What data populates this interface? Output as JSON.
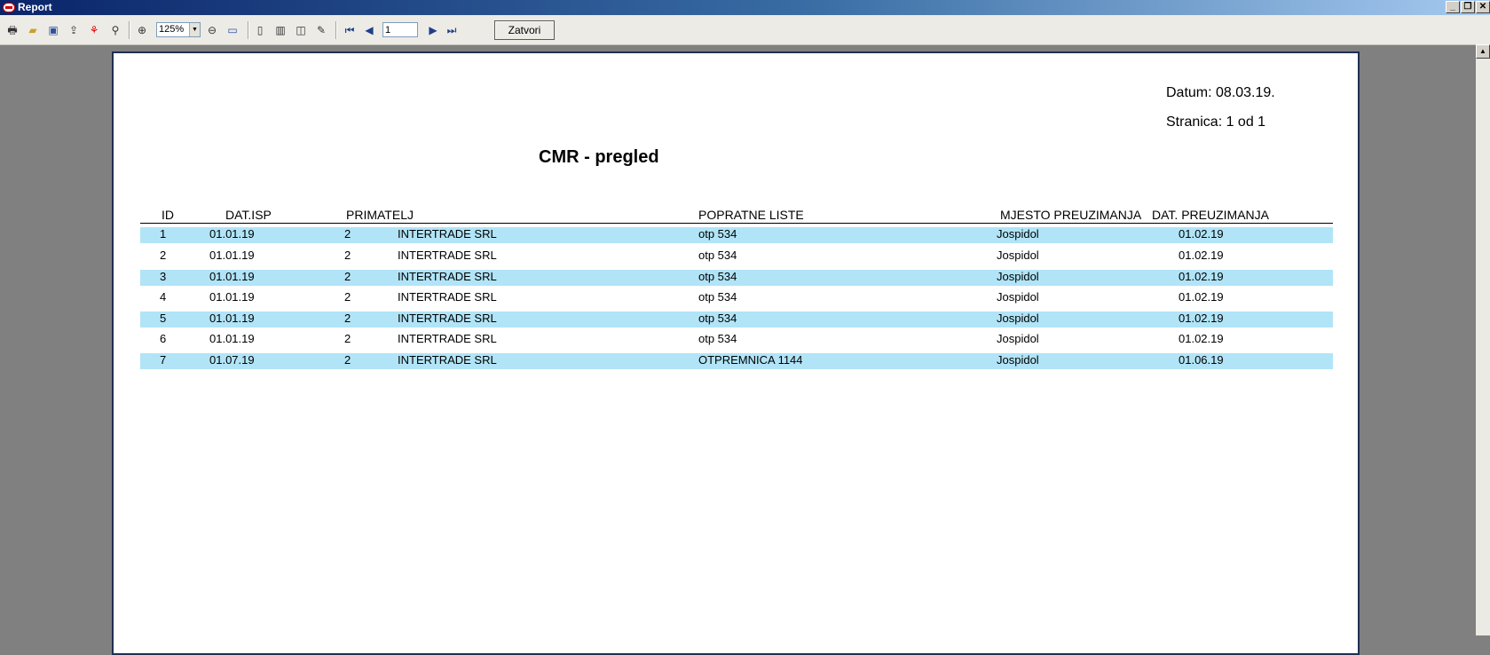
{
  "window": {
    "title": "Report"
  },
  "toolbar": {
    "zoom_value": "125%",
    "page_number": "1",
    "close_label": "Zatvori",
    "icons": [
      "print-icon",
      "open-icon",
      "save-icon",
      "export-icon",
      "pdf-icon",
      "find-icon",
      "zoom-in-icon",
      "zoom-out-icon",
      "fit-page-icon",
      "single-page-icon",
      "two-page-icon",
      "book-view-icon",
      "edit-icon",
      "first-page-icon",
      "prev-page-icon",
      "next-page-icon",
      "last-page-icon"
    ]
  },
  "report": {
    "datum": "Datum: 08.03.19.",
    "stranica": "Stranica: 1 od 1",
    "title": "CMR - pregled",
    "columns": [
      "ID",
      "DAT.ISP",
      "PRIMATELJ",
      "POPRATNE LISTE",
      "MJESTO PREUZIMANJA",
      "DAT. PREUZIMANJA"
    ],
    "rows": [
      {
        "id": "1",
        "dat_isp": "01.01.19",
        "prim_code": "2",
        "prim_name": "INTERTRADE SRL",
        "popratne": "otp 534",
        "mjesto": "Jospidol",
        "dat_preuz": "01.02.19"
      },
      {
        "id": "2",
        "dat_isp": "01.01.19",
        "prim_code": "2",
        "prim_name": "INTERTRADE SRL",
        "popratne": "otp 534",
        "mjesto": "Jospidol",
        "dat_preuz": "01.02.19"
      },
      {
        "id": "3",
        "dat_isp": "01.01.19",
        "prim_code": "2",
        "prim_name": "INTERTRADE SRL",
        "popratne": "otp 534",
        "mjesto": "Jospidol",
        "dat_preuz": "01.02.19"
      },
      {
        "id": "4",
        "dat_isp": "01.01.19",
        "prim_code": "2",
        "prim_name": "INTERTRADE SRL",
        "popratne": "otp 534",
        "mjesto": "Jospidol",
        "dat_preuz": "01.02.19"
      },
      {
        "id": "5",
        "dat_isp": "01.01.19",
        "prim_code": "2",
        "prim_name": "INTERTRADE SRL",
        "popratne": "otp 534",
        "mjesto": "Jospidol",
        "dat_preuz": "01.02.19"
      },
      {
        "id": "6",
        "dat_isp": "01.01.19",
        "prim_code": "2",
        "prim_name": "INTERTRADE SRL",
        "popratne": "otp 534",
        "mjesto": "Jospidol",
        "dat_preuz": "01.02.19"
      },
      {
        "id": "7",
        "dat_isp": "01.07.19",
        "prim_code": "2",
        "prim_name": "INTERTRADE SRL",
        "popratne": "OTPREMNICA 1144",
        "mjesto": "Jospidol",
        "dat_preuz": "01.06.19"
      }
    ]
  },
  "colors": {
    "row_alt": "#b1e4f7",
    "title_bar": "#0a246a"
  }
}
